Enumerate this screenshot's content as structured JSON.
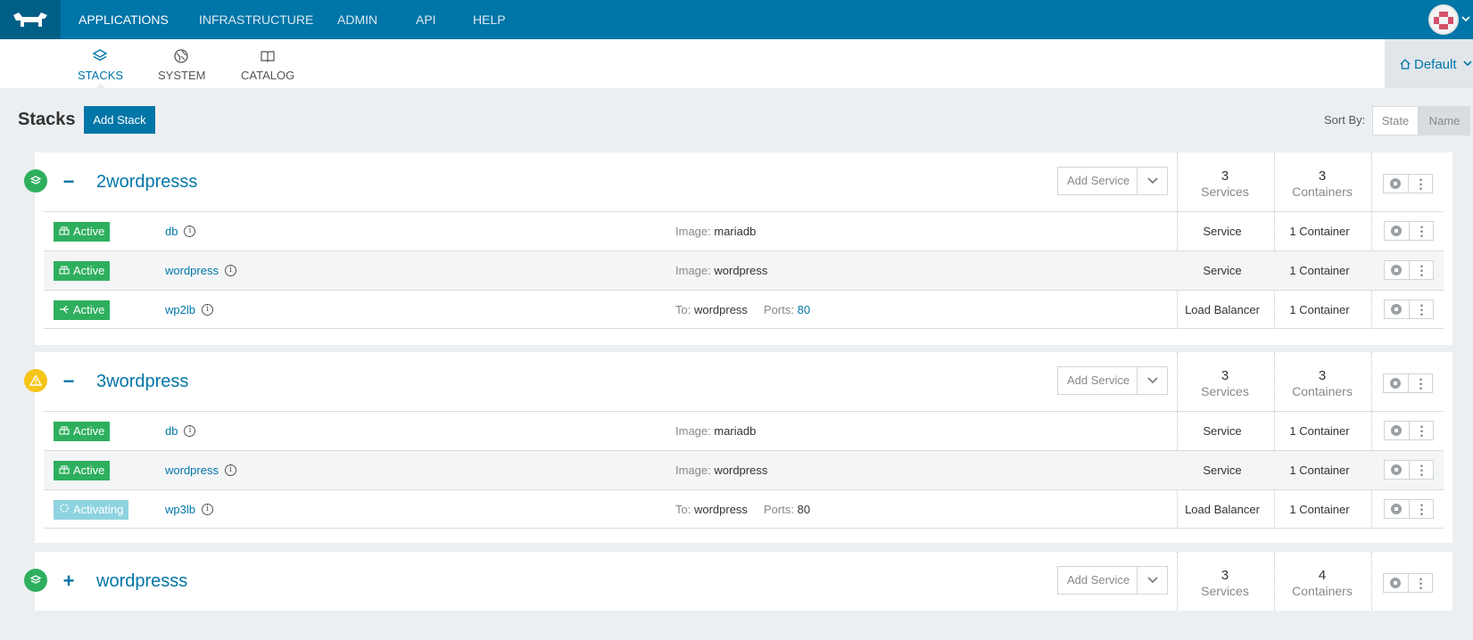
{
  "topnav": {
    "items": [
      "APPLICATIONS",
      "INFRASTRUCTURE",
      "ADMIN",
      "API",
      "HELP"
    ],
    "active": "APPLICATIONS"
  },
  "subnav": {
    "items": [
      {
        "label": "STACKS",
        "icon": "layers-icon"
      },
      {
        "label": "SYSTEM",
        "icon": "globe-icon"
      },
      {
        "label": "CATALOG",
        "icon": "book-icon"
      }
    ],
    "active": "STACKS"
  },
  "environment": {
    "label": "Default",
    "icon": "home-icon"
  },
  "page": {
    "title": "Stacks",
    "add_stack_label": "Add Stack"
  },
  "sort": {
    "label": "Sort By:",
    "options": [
      "State",
      "Name"
    ],
    "selected": "Name"
  },
  "stacks": [
    {
      "name": "2wordpresss",
      "state": "active",
      "expanded": true,
      "toggle": "−",
      "add_service_label": "Add Service",
      "services_count": "3",
      "services_label": "Services",
      "containers_count": "3",
      "containers_label": "Containers",
      "rows": [
        {
          "state": "Active",
          "icon": "service-icon",
          "name": "db",
          "k1": "Image:",
          "v1": "mariadb",
          "k2": "",
          "v2": "",
          "kind": "Service",
          "containers": "1 Container"
        },
        {
          "state": "Active",
          "icon": "service-icon",
          "name": "wordpress",
          "k1": "Image:",
          "v1": "wordpress",
          "k2": "",
          "v2": "",
          "kind": "Service",
          "containers": "1 Container"
        },
        {
          "state": "Active",
          "icon": "balancer-icon",
          "name": "wp2lb",
          "k1": "To:",
          "v1": "wordpress",
          "k2": "Ports:",
          "v2": "80",
          "kind": "Load Balancer",
          "containers": "1 Container"
        }
      ]
    },
    {
      "name": "3wordpress",
      "state": "warning",
      "expanded": true,
      "toggle": "−",
      "add_service_label": "Add Service",
      "services_count": "3",
      "services_label": "Services",
      "containers_count": "3",
      "containers_label": "Containers",
      "rows": [
        {
          "state": "Active",
          "icon": "service-icon",
          "name": "db",
          "k1": "Image:",
          "v1": "mariadb",
          "k2": "",
          "v2": "",
          "kind": "Service",
          "containers": "1 Container"
        },
        {
          "state": "Active",
          "icon": "service-icon",
          "name": "wordpress",
          "k1": "Image:",
          "v1": "wordpress",
          "k2": "",
          "v2": "",
          "kind": "Service",
          "containers": "1 Container"
        },
        {
          "state": "Activating",
          "icon": "spinner-icon",
          "name": "wp3lb",
          "k1": "To:",
          "v1": "wordpress",
          "k2": "Ports:",
          "v2": "80",
          "kind": "Load Balancer",
          "containers": "1 Container"
        }
      ]
    },
    {
      "name": "wordpresss",
      "state": "active",
      "expanded": false,
      "toggle": "+",
      "add_service_label": "Add Service",
      "services_count": "3",
      "services_label": "Services",
      "containers_count": "4",
      "containers_label": "Containers",
      "rows": []
    }
  ],
  "colors": {
    "brand": "#0075a8",
    "active": "#2eaf5e",
    "warning": "#f5c518",
    "activating": "#8fd3e0"
  }
}
